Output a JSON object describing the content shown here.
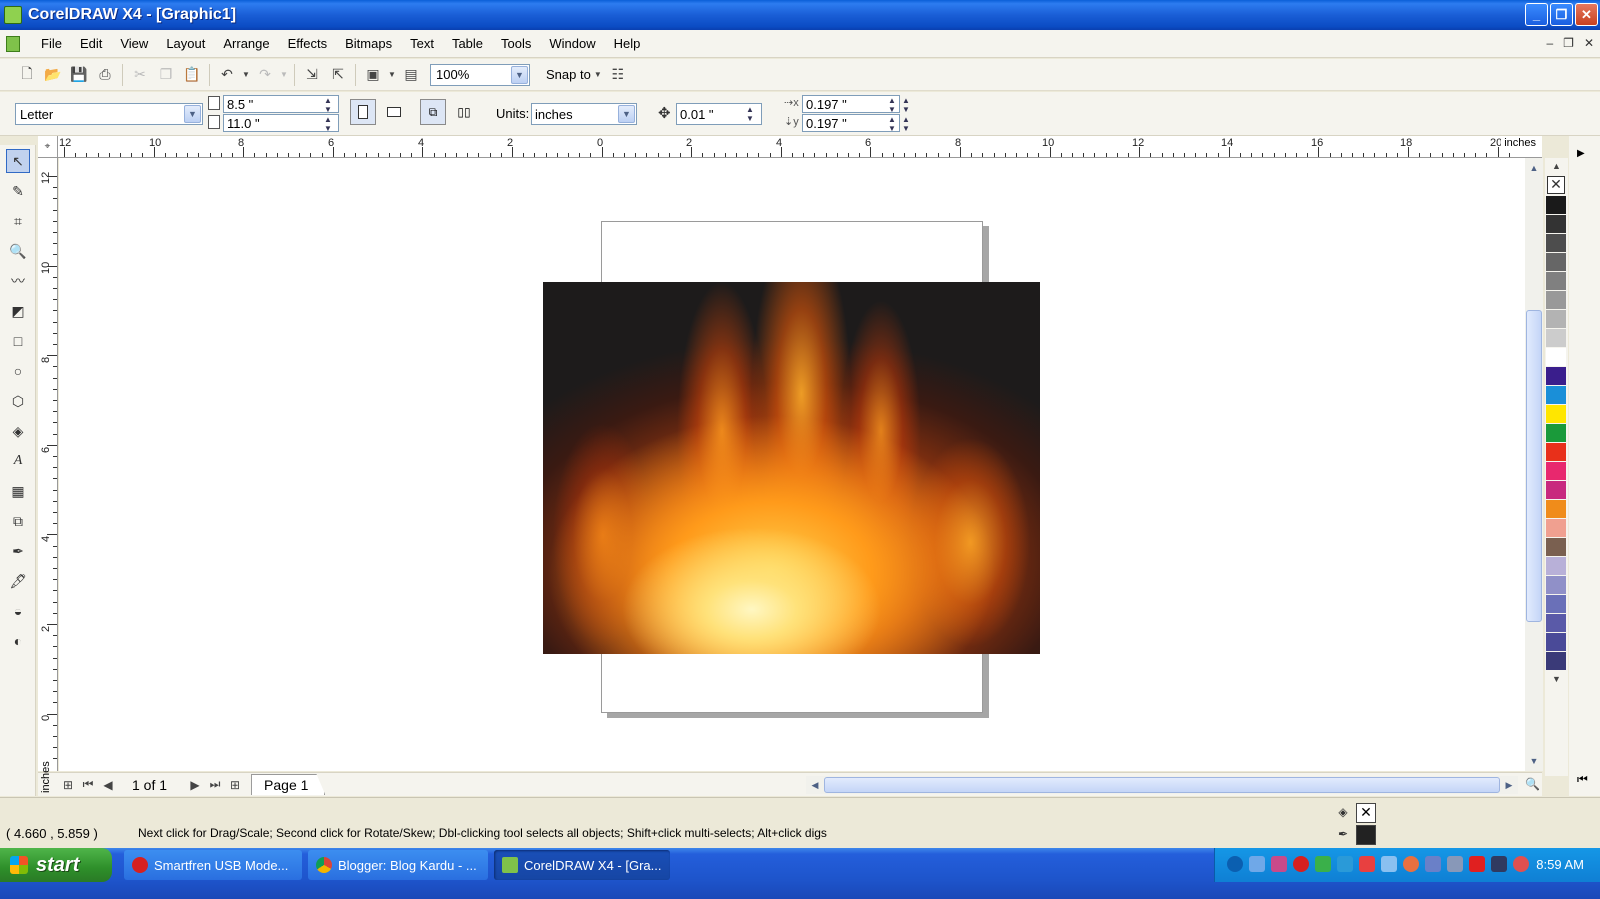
{
  "window": {
    "title": "CorelDRAW X4 - [Graphic1]"
  },
  "menu": [
    "File",
    "Edit",
    "View",
    "Layout",
    "Arrange",
    "Effects",
    "Bitmaps",
    "Text",
    "Table",
    "Tools",
    "Window",
    "Help"
  ],
  "toolbar": {
    "zoom": "100%",
    "snap_to": "Snap to"
  },
  "property_bar": {
    "paper": "Letter",
    "width": "8.5 \"",
    "height": "11.0 \"",
    "units_label": "Units:",
    "units": "inches",
    "nudge": "0.01 \"",
    "dup_x": "0.197 \"",
    "dup_y": "0.197 \""
  },
  "rulers": {
    "horizontal_labels": [
      "12",
      "10",
      "8",
      "6",
      "4",
      "2",
      "0",
      "2",
      "4",
      "6",
      "8",
      "10",
      "12",
      "14",
      "16",
      "18",
      "20"
    ],
    "horizontal_units": "inches",
    "vertical_labels": [
      "12",
      "10",
      "8",
      "6",
      "4",
      "2",
      "0"
    ],
    "vertical_units": "inches"
  },
  "page_nav": {
    "count": "1 of 1",
    "tab": "Page 1"
  },
  "palette": {
    "colors": [
      "#1a1a1a",
      "#333333",
      "#4d4d4d",
      "#666666",
      "#808080",
      "#999999",
      "#b3b3b3",
      "#cccccc",
      "#ffffff",
      "#3a1e8c",
      "#1a8fd8",
      "#ffe600",
      "#1a9a3a",
      "#e8301a",
      "#e8286e",
      "#c8287e",
      "#f08c1a",
      "#f0a090",
      "#7a6050",
      "#b8b0d8",
      "#9090c8",
      "#6a70b8",
      "#5a5aa8",
      "#4a4a98",
      "#3a3a78"
    ]
  },
  "status": {
    "coords": "( 4.660 , 5.859 )",
    "hint": "Next click for Drag/Scale; Second click for Rotate/Skew; Dbl-clicking tool selects all objects; Shift+click multi-selects; Alt+click digs"
  },
  "taskbar": {
    "start": "start",
    "tasks": [
      "Smartfren USB Mode...",
      "Blogger: Blog Kardu - ...",
      "CorelDRAW X4 - [Gra..."
    ],
    "clock": "8:59 AM"
  }
}
